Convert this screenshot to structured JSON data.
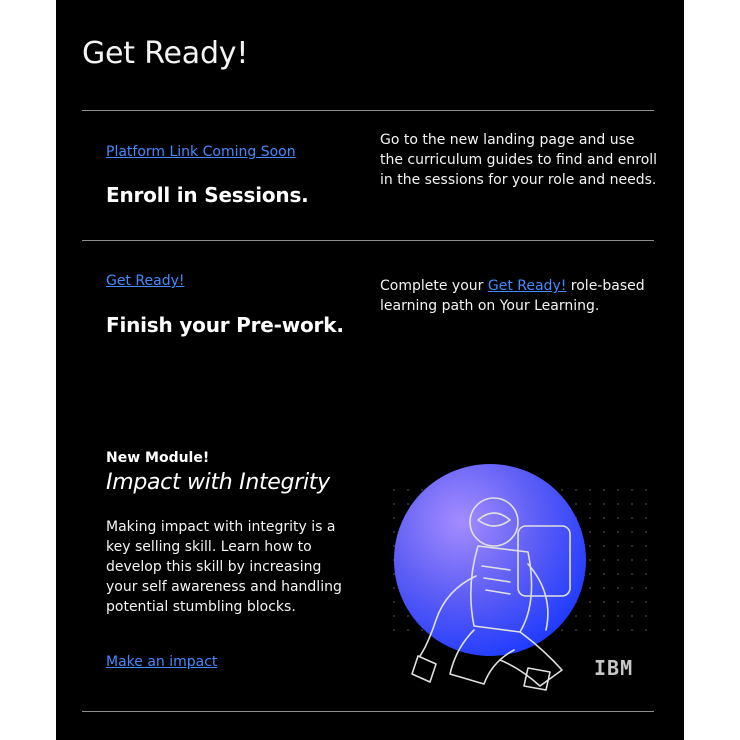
{
  "header": {
    "title": "Get Ready!"
  },
  "steps": [
    {
      "link": "Platform Link Coming Soon",
      "heading": "Enroll in Sessions.",
      "description": "Go to the new landing page and use the curriculum guides to find and enroll in the sessions for your role and needs."
    },
    {
      "link": "Get Ready!",
      "heading": "Finish your Pre-work.",
      "description_before": "Complete your ",
      "description_link": "Get Ready!",
      "description_after": " role-based learning path on Your Learning."
    }
  ],
  "module": {
    "badge": "New Module!",
    "title": "Impact with Integrity",
    "body": "Making impact with integrity is a key selling skill. Learn how to develop this skill by increasing your self awareness and handling potential stumbling blocks.",
    "cta": "Make an impact",
    "illustration": "astronaut-illustration",
    "logo": "IBM"
  },
  "colors": {
    "background": "#000000",
    "link": "#4589ff",
    "rule": "#8d8d8d",
    "accent_circle": "#4f6bff"
  }
}
